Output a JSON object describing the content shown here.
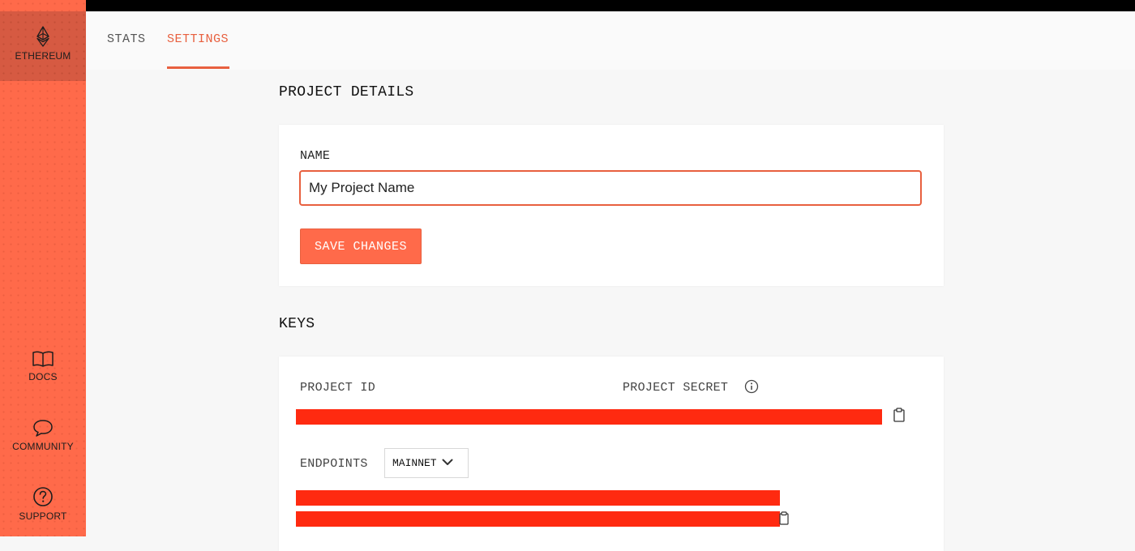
{
  "sidebar": {
    "items": [
      {
        "label": "ETHEREUM",
        "icon": "ethereum-icon"
      },
      {
        "label": "DOCS",
        "icon": "book-icon"
      },
      {
        "label": "COMMUNITY",
        "icon": "chat-bubble-icon"
      },
      {
        "label": "SUPPORT",
        "icon": "question-circle-icon"
      }
    ]
  },
  "tabs": [
    {
      "label": "STATS"
    },
    {
      "label": "SETTINGS"
    }
  ],
  "project_details": {
    "title": "PROJECT DETAILS",
    "name_label": "NAME",
    "name_value": "My Project Name",
    "save_label": "SAVE CHANGES"
  },
  "keys": {
    "title": "KEYS",
    "project_id_label": "PROJECT ID",
    "project_secret_label": "PROJECT SECRET",
    "endpoints_label": "ENDPOINTS",
    "network_selected": "MAINNET"
  },
  "colors": {
    "accent": "#e8603f",
    "sidebar": "#ff6a4a",
    "redaction": "#ff2a10"
  }
}
